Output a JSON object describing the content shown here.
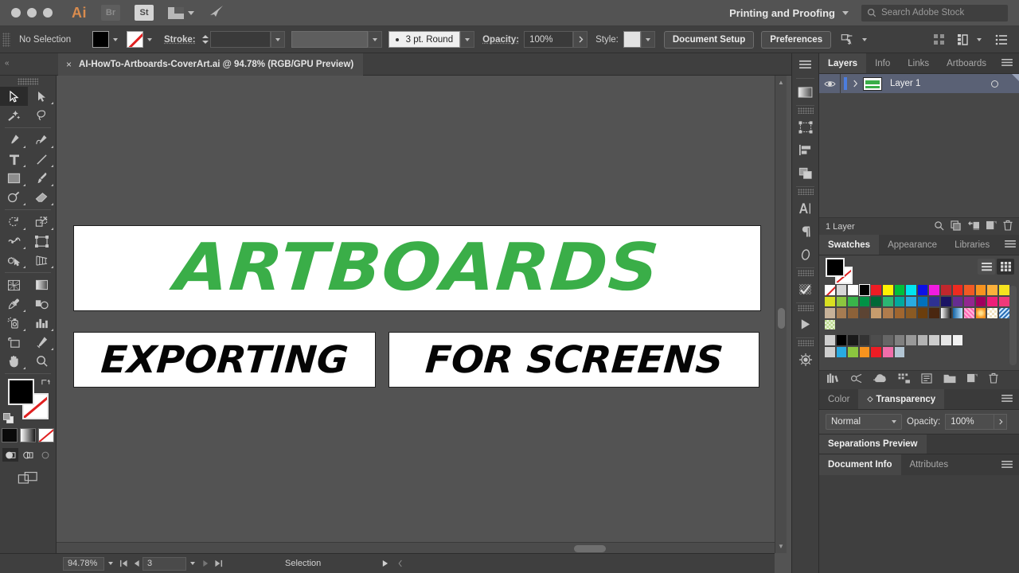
{
  "menubar": {
    "app_logo": "Ai",
    "apps": [
      {
        "name": "bridge-chip",
        "label": "Br"
      },
      {
        "name": "stock-chip",
        "label": "St"
      }
    ],
    "arrange_icon": "arrange-documents-icon",
    "rocket_icon": "share-icon",
    "workspace": "Printing and Proofing",
    "workspace_chevron": "chevron-down-icon",
    "search_placeholder": "Search Adobe Stock",
    "search_value": "",
    "search_icon": "search-icon"
  },
  "controlbar": {
    "selection_status": "No Selection",
    "fill_label": "fill-swatch",
    "fill_color": "#000000",
    "stroke_swatch_label": "stroke-swatch-none",
    "stroke_label": "Stroke:",
    "stroke_weight_value": "",
    "brush_definition": "3 pt. Round",
    "opacity_label": "Opacity:",
    "opacity_value": "100%",
    "style_label": "Style:",
    "document_setup": "Document Setup",
    "preferences": "Preferences",
    "select_similar_icon": "select-similar-options-icon",
    "align_icon": "align-grid-icon",
    "distribute_icon": "distribute-icon",
    "more_options_icon": "panel-list-icon"
  },
  "tabbar": {
    "close_glyph": "×",
    "document_title": "AI-HowTo-Artboards-CoverArt.ai @ 94.78% (RGB/GPU Preview)"
  },
  "toolbar": {
    "tools": [
      {
        "name": "selection-tool",
        "selected": true,
        "corner": false
      },
      {
        "name": "direct-selection-tool",
        "selected": false,
        "corner": true
      },
      {
        "name": "magic-wand-tool",
        "selected": false,
        "corner": false
      },
      {
        "name": "lasso-tool",
        "selected": false,
        "corner": false
      },
      {
        "name": "pen-tool",
        "selected": false,
        "corner": true
      },
      {
        "name": "curvature-tool",
        "selected": false,
        "corner": true
      },
      {
        "name": "type-tool",
        "selected": false,
        "corner": true
      },
      {
        "name": "line-segment-tool",
        "selected": false,
        "corner": true
      },
      {
        "name": "rectangle-tool",
        "selected": false,
        "corner": true
      },
      {
        "name": "paintbrush-tool",
        "selected": false,
        "corner": true
      },
      {
        "name": "shaper-tool",
        "selected": false,
        "corner": true
      },
      {
        "name": "eraser-tool",
        "selected": false,
        "corner": true
      },
      {
        "name": "rotate-tool",
        "selected": false,
        "corner": true
      },
      {
        "name": "scale-tool",
        "selected": false,
        "corner": true
      },
      {
        "name": "width-tool",
        "selected": false,
        "corner": true
      },
      {
        "name": "free-transform-tool",
        "selected": false,
        "corner": false
      },
      {
        "name": "shape-builder-tool",
        "selected": false,
        "corner": true
      },
      {
        "name": "perspective-grid-tool",
        "selected": false,
        "corner": true
      },
      {
        "name": "mesh-tool",
        "selected": false,
        "corner": false
      },
      {
        "name": "gradient-tool",
        "selected": false,
        "corner": false
      },
      {
        "name": "eyedropper-tool",
        "selected": false,
        "corner": true
      },
      {
        "name": "blend-tool",
        "selected": false,
        "corner": false
      },
      {
        "name": "symbol-sprayer-tool",
        "selected": false,
        "corner": true
      },
      {
        "name": "column-graph-tool",
        "selected": false,
        "corner": true
      },
      {
        "name": "artboard-tool",
        "selected": false,
        "corner": false
      },
      {
        "name": "slice-tool",
        "selected": false,
        "corner": true
      },
      {
        "name": "hand-tool",
        "selected": false,
        "corner": true
      },
      {
        "name": "zoom-tool",
        "selected": false,
        "corner": false
      }
    ],
    "fill_color": "#000000",
    "stroke_color": "none",
    "color_modes": [
      {
        "name": "color-mode-button",
        "type": "color"
      },
      {
        "name": "gradient-mode-button",
        "type": "gradient"
      },
      {
        "name": "none-mode-button",
        "type": "none"
      }
    ],
    "draw_modes": [
      {
        "name": "draw-normal-button",
        "active": true
      },
      {
        "name": "draw-behind-button",
        "active": false
      },
      {
        "name": "draw-inside-button",
        "active": false
      }
    ],
    "screen_mode": "change-screen-mode-button"
  },
  "canvas": {
    "artboards": [
      {
        "name": "artboard-title",
        "text": "ARTBOARDS",
        "color": "#3aae48"
      },
      {
        "name": "artboard-subtitle-left",
        "text": "EXPORTING",
        "color": "#050505"
      },
      {
        "name": "artboard-subtitle-right",
        "text": "FOR SCREENS",
        "color": "#050505"
      }
    ],
    "background": "#535353"
  },
  "statusbar": {
    "zoom_level": "94.78%",
    "zoom_chevron": "chevron-down-icon",
    "first_artboard_icon": "first-artboard-icon",
    "prev_artboard_icon": "previous-artboard-icon",
    "artboard_number": "3",
    "artboard_chevron": "chevron-down-icon",
    "next_artboard_icon": "next-artboard-icon",
    "last_artboard_icon": "last-artboard-icon",
    "status_text": "Selection",
    "status_play_icon": "play-icon",
    "status_resize_icon": "resize-grip-icon"
  },
  "icondock": {
    "collapse_icon": "collapse-panels-icon",
    "items": [
      {
        "name": "gradient-panel-icon"
      },
      {
        "name": "transform-panel-icon"
      },
      {
        "name": "align-panel-icon"
      },
      {
        "name": "pathfinder-panel-icon"
      },
      {
        "name": "character-panel-icon"
      },
      {
        "name": "paragraph-panel-icon"
      },
      {
        "name": "glyphs-panel-icon"
      },
      {
        "name": "transparency-panel-icon"
      },
      {
        "name": "video-panel-icon"
      },
      {
        "name": "symbols-panel-icon"
      }
    ]
  },
  "panels": {
    "layers": {
      "tabs": [
        {
          "label": "Layers",
          "active": true
        },
        {
          "label": "Info",
          "active": false
        },
        {
          "label": "Links",
          "active": false
        },
        {
          "label": "Artboards",
          "active": false
        }
      ],
      "menu_icon": "panel-menu-icon",
      "rows": [
        {
          "name": "layer-row",
          "label": "Layer 1",
          "visible": true,
          "eye_icon": "eye-icon",
          "expand_icon": "chevron-right-icon",
          "selected": true,
          "selection_color": "#4b7de0"
        }
      ],
      "footer_text": "1 Layer",
      "footer_icons": [
        {
          "name": "locate-object-icon"
        },
        {
          "name": "make-clipping-mask-icon"
        },
        {
          "name": "create-new-sublayer-icon"
        },
        {
          "name": "create-new-layer-icon"
        },
        {
          "name": "delete-layer-icon"
        }
      ]
    },
    "swatches": {
      "tabs": [
        {
          "label": "Swatches",
          "active": true
        },
        {
          "label": "Appearance",
          "active": false
        },
        {
          "label": "Libraries",
          "active": false
        }
      ],
      "menu_icon": "panel-menu-icon",
      "fill_color": "#000000",
      "stroke_color": "none",
      "view_list_icon": "list-view-icon",
      "view_grid_icon": "grid-view-icon",
      "rows": [
        [
          "none",
          "registration",
          "#ffffff",
          "#000000",
          "#ed1c24",
          "#fff200",
          "#00a651",
          "#00aeef",
          "#2e3192",
          "#ec008c",
          "#c1272d",
          "#ed1c24",
          "#f15a24",
          "#f7931e",
          "#fbb03b",
          "#fff200"
        ],
        [
          "#d9e021",
          "#8cc63f",
          "#39b54a",
          "#009245",
          "#006837",
          "#2bb673",
          "#00a99d",
          "#29abe2",
          "#0071bc",
          "#2e3192",
          "#1b1464",
          "#662d91",
          "#92278f",
          "#9e005d",
          "#ed1e79",
          "#f0397a"
        ],
        [
          "#c7b299",
          "#a67c52",
          "#8c6239",
          "#754c24",
          "#c69c6d",
          "#b07c4c",
          "#a0662f",
          "#8a5a23",
          "#7a4a14",
          "#603813",
          "gradient-bw",
          "gradient-blue",
          "pattern-pink",
          "pattern-orange",
          "pattern-checker",
          "pattern-blue"
        ],
        [
          "pattern-confetti"
        ],
        [
          "folder",
          "#000000",
          "#1a1a1a",
          "#333333",
          "#4d4d4d",
          "#666666",
          "#808080",
          "#999999",
          "#b3b3b3",
          "#cccccc",
          "#e6e6e6",
          "#f2f2f2"
        ],
        [
          "folder",
          "#29abe2",
          "#8cc63f",
          "#f7931e",
          "#ed1c24",
          "#f06eaa",
          "#b3c6d4"
        ]
      ],
      "footer_icons": [
        {
          "name": "swatch-libraries-icon"
        },
        {
          "name": "show-swatch-kinds-icon"
        },
        {
          "name": "add-to-library-icon"
        },
        {
          "name": "new-color-group-icon"
        },
        {
          "name": "swatch-options-icon"
        },
        {
          "name": "new-color-group-folder-icon"
        },
        {
          "name": "new-swatch-icon"
        },
        {
          "name": "delete-swatch-icon"
        }
      ]
    },
    "transparency": {
      "tabs": [
        {
          "label": "Color",
          "active": false,
          "diamond": false
        },
        {
          "label": "Transparency",
          "active": true,
          "diamond": true
        }
      ],
      "menu_icon": "panel-menu-icon",
      "blend_mode": "Normal",
      "blend_chevron": "chevron-down-icon",
      "opacity_label": "Opacity:",
      "opacity_value": "100%",
      "opacity_arrow": "chevron-right-icon"
    },
    "separations": {
      "tabs": [
        {
          "label": "Separations Preview",
          "active": true
        }
      ]
    },
    "documentinfo": {
      "tabs": [
        {
          "label": "Document Info",
          "active": true
        },
        {
          "label": "Attributes",
          "active": false
        }
      ],
      "menu_icon": "panel-menu-icon"
    }
  }
}
